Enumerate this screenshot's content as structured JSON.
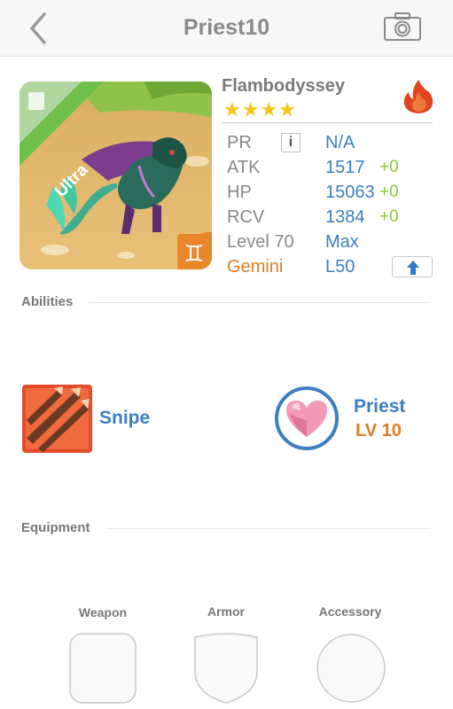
{
  "nav": {
    "title": "Priest10"
  },
  "monster": {
    "name": "Flambodyssey",
    "stars": "★★★★",
    "rarity": "Ultra",
    "element_color": "#e0451f"
  },
  "stats": {
    "pr": {
      "label": "PR",
      "value": "N/A"
    },
    "atk": {
      "label": "ATK",
      "value": "1517",
      "bonus": "+0"
    },
    "hp": {
      "label": "HP",
      "value": "15063",
      "bonus": "+0"
    },
    "rcv": {
      "label": "RCV",
      "value": "1384",
      "bonus": "+0"
    },
    "level": {
      "label": "Level 70",
      "value": "Max"
    },
    "sign": {
      "label": "Gemini",
      "value": "L50"
    }
  },
  "sections": {
    "abilities": "Abilities",
    "equipment": "Equipment"
  },
  "ability": {
    "name": "Snipe"
  },
  "class_info": {
    "name": "Priest",
    "level": "LV 10"
  },
  "equipment": {
    "weapon": "Weapon",
    "armor": "Armor",
    "accessory": "Accessory"
  },
  "colors": {
    "accent_blue": "#3d7fc1",
    "accent_orange": "#e07d25",
    "accent_green": "#8cc63f",
    "star": "#f5c518"
  }
}
